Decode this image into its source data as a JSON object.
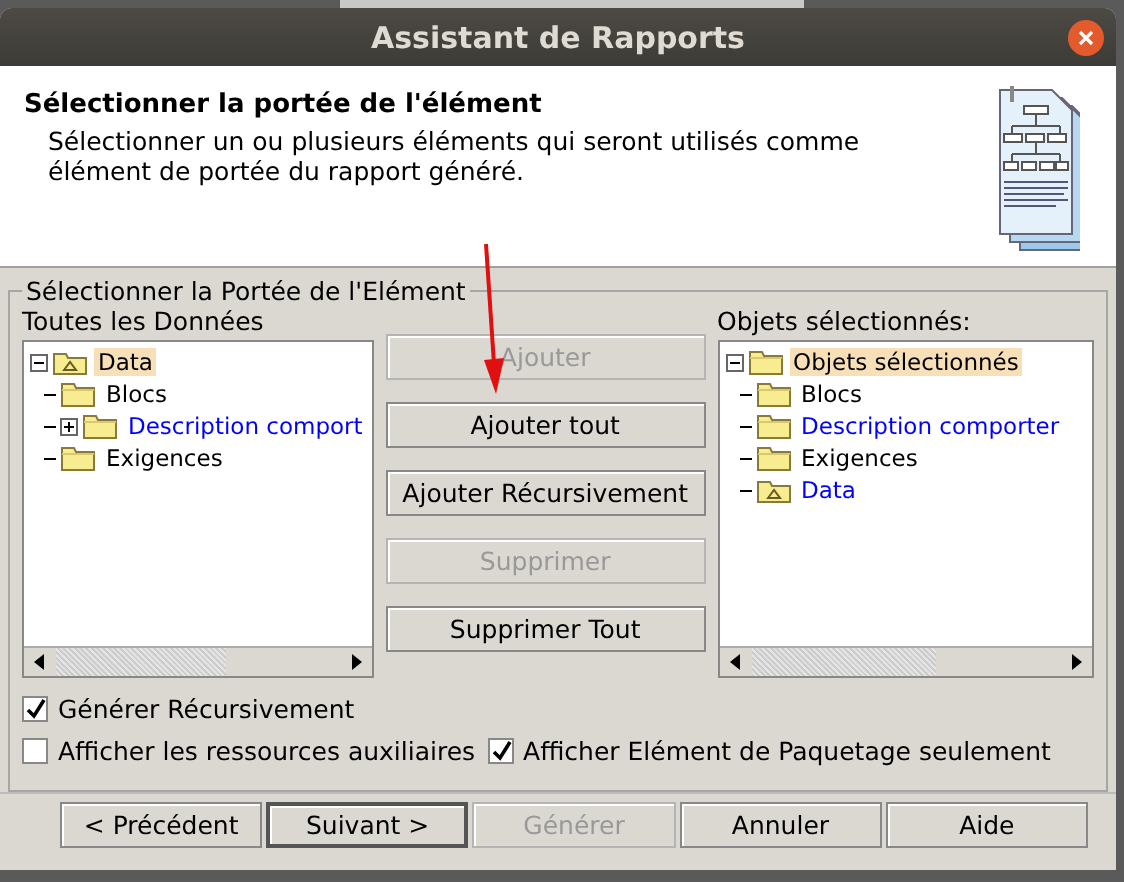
{
  "window": {
    "title": "Assistant de Rapports"
  },
  "header": {
    "title": "Sélectionner la portée de l'élément",
    "description": "Sélectionner un ou plusieurs éléments qui seront utilisés comme élément de portée du rapport généré."
  },
  "group": {
    "title": "Sélectionner la Portée de l'Elément",
    "available": {
      "label": "Toutes les Données",
      "tree": [
        {
          "label": "Data",
          "kind": "package",
          "color": "#000000",
          "selected": true,
          "expanded": true,
          "children": [
            {
              "label": "Blocs",
              "kind": "folder",
              "color": "#000000",
              "selected": false
            },
            {
              "label": "Description comport",
              "kind": "folder",
              "color": "#0000ff",
              "selected": false,
              "expanded": false
            },
            {
              "label": "Exigences",
              "kind": "folder",
              "color": "#000000",
              "selected": false
            }
          ]
        }
      ]
    },
    "actions": [
      {
        "label": "Ajouter",
        "disabled": true
      },
      {
        "label": "Ajouter tout",
        "disabled": false
      },
      {
        "label": "Ajouter Récursivement",
        "disabled": false
      },
      {
        "label": "Supprimer",
        "disabled": true
      },
      {
        "label": "Supprimer Tout",
        "disabled": false
      }
    ],
    "selected": {
      "label": "Objets sélectionnés:",
      "tree": [
        {
          "label": "Objets sélectionnés",
          "kind": "folder",
          "color": "#000000",
          "selected": true,
          "expanded": true,
          "children": [
            {
              "label": "Blocs",
              "kind": "folder",
              "color": "#000000",
              "selected": false
            },
            {
              "label": "Description comporter",
              "kind": "folder",
              "color": "#0000ff",
              "selected": false
            },
            {
              "label": "Exigences",
              "kind": "folder",
              "color": "#000000",
              "selected": false
            },
            {
              "label": "Data",
              "kind": "package",
              "color": "#0000ff",
              "selected": false
            }
          ]
        }
      ]
    },
    "options": [
      {
        "label": "Générer Récursivement",
        "checked": true
      },
      {
        "label": "Afficher les ressources auxiliaires",
        "checked": false
      },
      {
        "label": "Afficher Elément de Paquetage seulement",
        "checked": true
      }
    ]
  },
  "buttons": [
    {
      "label": "< Précédent",
      "disabled": false,
      "default": false
    },
    {
      "label": "Suivant >",
      "disabled": false,
      "default": true
    },
    {
      "label": "Générer",
      "disabled": true,
      "default": false
    },
    {
      "label": "Annuler",
      "disabled": false,
      "default": false
    },
    {
      "label": "Aide",
      "disabled": false,
      "default": false
    }
  ]
}
